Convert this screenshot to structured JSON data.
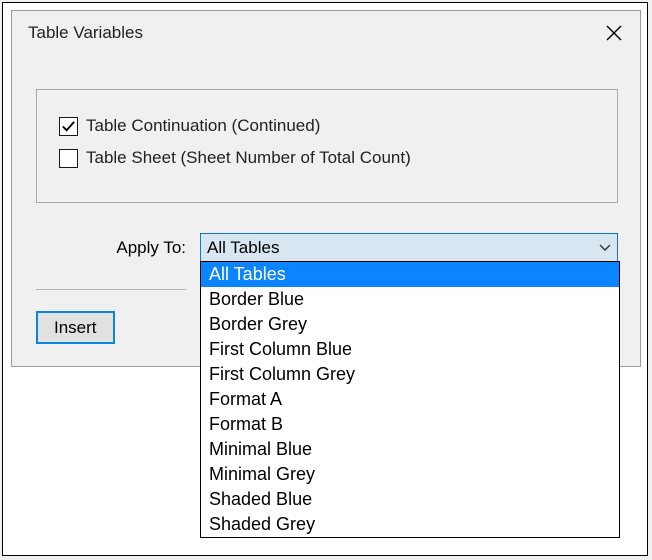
{
  "title": "Table Variables",
  "checks": {
    "continuation": {
      "label": "Table Continuation (Continued)",
      "checked": true
    },
    "sheet": {
      "label": "Table Sheet (Sheet Number of Total Count)",
      "checked": false
    }
  },
  "applyTo": {
    "label": "Apply To:",
    "value": "All Tables",
    "options": [
      "All Tables",
      "Border Blue",
      "Border Grey",
      "First Column Blue",
      "First Column Grey",
      "Format A",
      "Format B",
      "Minimal Blue",
      "Minimal Grey",
      "Shaded Blue",
      "Shaded Grey"
    ],
    "selectedIndex": 0
  },
  "insert": "Insert"
}
